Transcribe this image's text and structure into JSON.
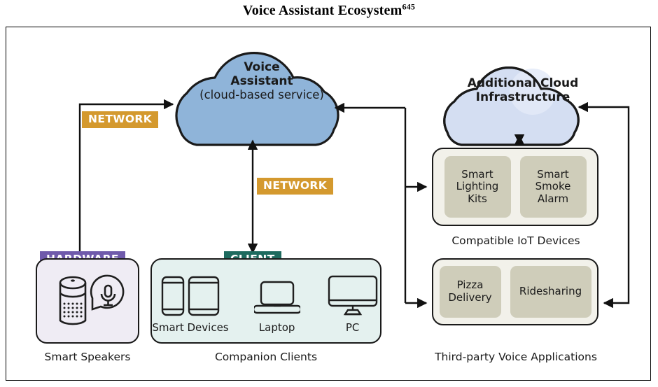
{
  "title": {
    "text": "Voice Assistant Ecosystem",
    "superscript": "645"
  },
  "clouds": {
    "voice_assistant": {
      "line1": "Voice",
      "line2": "Assistant",
      "line3": "(cloud-based service)",
      "fill": "#8fb4d9",
      "stroke": "#1a1a1a"
    },
    "additional_cloud": {
      "line1": "Additional Cloud",
      "line2": "Infrastructure",
      "fill": "#d4def2",
      "fill_secondary": "#e3eaf8",
      "stroke": "#1a1a1a"
    }
  },
  "badges": {
    "network_left": {
      "label": "NETWORK",
      "color": "#d4992e"
    },
    "network_middle": {
      "label": "NETWORK",
      "color": "#d4992e"
    },
    "hardware": {
      "label": "HARDWARE",
      "color": "#6f5aab"
    },
    "client": {
      "label": "CLIENT",
      "color": "#1d6a5e"
    }
  },
  "nodes": {
    "smart_speakers": {
      "caption": "Smart Speakers",
      "fill": "#efecf4",
      "icons": [
        "smart-speaker-icon",
        "voice-bubble-microphone-icon"
      ]
    },
    "companion_clients": {
      "caption": "Companion Clients",
      "fill": "#e4f1ef",
      "devices": [
        {
          "label": "Smart Devices",
          "icons": [
            "phone-icon",
            "tablet-icon"
          ]
        },
        {
          "label": "Laptop",
          "icons": [
            "laptop-icon"
          ]
        },
        {
          "label": "PC",
          "icons": [
            "desktop-monitor-icon"
          ]
        }
      ]
    },
    "compatible_iot": {
      "caption": "Compatible IoT Devices",
      "fill": "#f2f1ea",
      "tile_fill": "#cfcdba",
      "tiles": [
        "Smart\nLighting\nKits",
        "Smart\nSmoke\nAlarm"
      ],
      "tile_items": [
        {
          "l1": "Smart",
          "l2": "Lighting",
          "l3": "Kits"
        },
        {
          "l1": "Smart",
          "l2": "Smoke",
          "l3": "Alarm"
        }
      ]
    },
    "third_party": {
      "caption": "Third-party Voice Applications",
      "fill": "#f2f1ea",
      "tile_fill": "#cfcdba",
      "tile_items": [
        {
          "l1": "Pizza",
          "l2": "Delivery"
        },
        {
          "l1": "Ridesharing"
        }
      ]
    }
  },
  "connectors": [
    {
      "name": "smart-speakers-to-voice-assistant",
      "from": "Smart Speakers",
      "to": "Voice Assistant",
      "direction": "one-way",
      "label": "NETWORK"
    },
    {
      "name": "companion-clients-to-voice-assistant",
      "from": "Companion Clients",
      "to": "Voice Assistant",
      "direction": "two-way",
      "label": "NETWORK"
    },
    {
      "name": "voice-assistant-to-iot",
      "from": "Voice Assistant",
      "to": "Compatible IoT Devices",
      "direction": "one-way",
      "label": ""
    },
    {
      "name": "voice-assistant-to-third-party",
      "from": "Voice Assistant",
      "to": "Third-party Voice Applications",
      "direction": "one-way",
      "label": ""
    },
    {
      "name": "additional-cloud-to-iot",
      "from": "Additional Cloud Infrastructure",
      "to": "Compatible IoT Devices",
      "direction": "two-way",
      "label": ""
    },
    {
      "name": "third-party-to-additional-cloud",
      "from": "Third-party Voice Applications",
      "to": "Additional Cloud Infrastructure",
      "direction": "two-way",
      "label": ""
    }
  ]
}
